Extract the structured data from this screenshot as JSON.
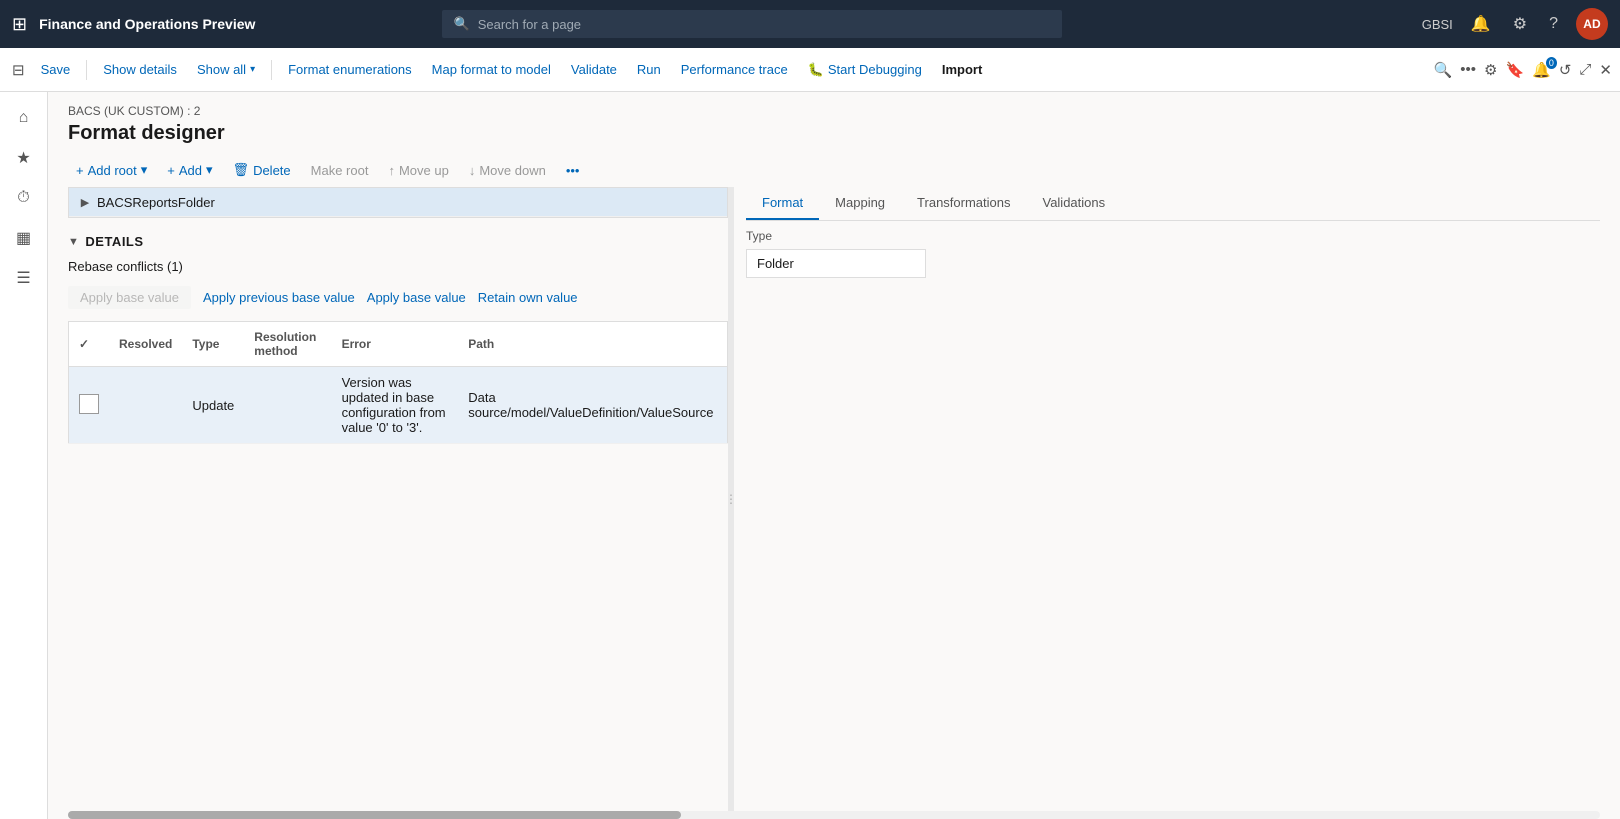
{
  "app": {
    "title": "Finance and Operations Preview",
    "user_initials": "AD",
    "user_org": "GBSI"
  },
  "search": {
    "placeholder": "Search for a page"
  },
  "toolbar": {
    "save_label": "Save",
    "show_details_label": "Show details",
    "show_all_label": "Show all",
    "format_enumerations_label": "Format enumerations",
    "map_format_label": "Map format to model",
    "validate_label": "Validate",
    "run_label": "Run",
    "performance_trace_label": "Performance trace",
    "start_debugging_label": "Start Debugging",
    "import_label": "Import"
  },
  "page": {
    "breadcrumb": "BACS (UK CUSTOM) : 2",
    "title": "Format designer"
  },
  "format_toolbar": {
    "add_root_label": "Add root",
    "add_label": "Add",
    "delete_label": "Delete",
    "make_root_label": "Make root",
    "move_up_label": "Move up",
    "move_down_label": "Move down"
  },
  "tabs": {
    "format_label": "Format",
    "mapping_label": "Mapping",
    "transformations_label": "Transformations",
    "validations_label": "Validations"
  },
  "type_section": {
    "label": "Type",
    "value": "Folder"
  },
  "tree": {
    "items": [
      {
        "label": "BACSReportsFolder",
        "level": 0,
        "selected": true,
        "expandable": true
      }
    ]
  },
  "details": {
    "section_label": "DETAILS",
    "conflicts_title": "Rebase conflicts (1)",
    "apply_previous_label": "Apply previous base value",
    "apply_base_label": "Apply base value",
    "retain_own_label": "Retain own value"
  },
  "table": {
    "headers": {
      "resolved": "Resolved",
      "type": "Type",
      "resolution_method": "Resolution method",
      "error": "Error",
      "path": "Path"
    },
    "rows": [
      {
        "resolved": false,
        "type": "Update",
        "resolution_method": "",
        "error": "Version was updated in base configuration from value '0' to '3'.",
        "path": "Data source/model/ValueDefinition/ValueSource"
      }
    ]
  },
  "sidebar": {
    "items": [
      {
        "icon": "☰",
        "name": "menu-icon"
      },
      {
        "icon": "⌂",
        "name": "home-icon"
      },
      {
        "icon": "★",
        "name": "favorites-icon"
      },
      {
        "icon": "⏱",
        "name": "recent-icon"
      },
      {
        "icon": "▦",
        "name": "workspaces-icon"
      },
      {
        "icon": "☰",
        "name": "list-icon"
      }
    ]
  },
  "colors": {
    "accent": "#0067b8",
    "nav_bg": "#1e2a3a",
    "selected_row": "#dce9f5",
    "data_row_bg": "#e8f0f8"
  }
}
